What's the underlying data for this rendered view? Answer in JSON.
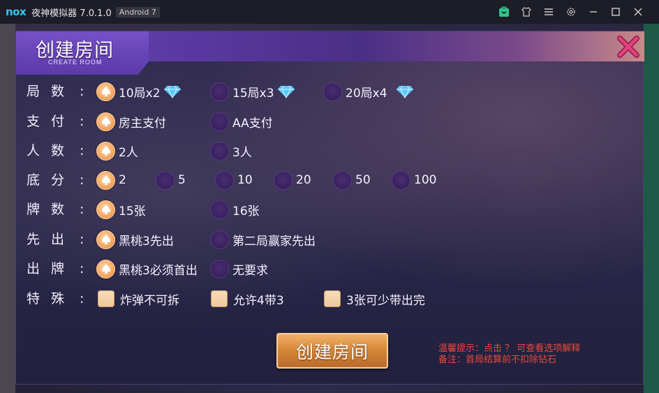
{
  "window": {
    "logo": "nox",
    "title": "夜神模拟器 7.0.1.0",
    "badge": "Android 7",
    "icons": [
      "shop-icon",
      "shirt-icon",
      "menu-icon",
      "gear-icon",
      "minimize-icon",
      "maximize-icon",
      "close-icon"
    ]
  },
  "dialog": {
    "title": "创建房间",
    "subtitle": "CREATE ROOM",
    "colors": {
      "accent_selected": "#f3a865",
      "radio_unselected": "#371f5c",
      "header": "#5a3aa3",
      "note": "#ea4a3a",
      "close": "#e0417c"
    }
  },
  "rows": [
    {
      "label": "局数",
      "colon": ":",
      "options": [
        {
          "text": "10局x2",
          "selected": true,
          "gem": true
        },
        {
          "text": "15局x3",
          "selected": false,
          "gem": true
        },
        {
          "text": "20局x4",
          "selected": false,
          "gem": true
        }
      ]
    },
    {
      "label": "支付",
      "colon": ":",
      "options": [
        {
          "text": "房主支付",
          "selected": true
        },
        {
          "text": "AA支付",
          "selected": false
        }
      ]
    },
    {
      "label": "人数",
      "colon": ":",
      "options": [
        {
          "text": "2人",
          "selected": true
        },
        {
          "text": "3人",
          "selected": false
        }
      ]
    },
    {
      "label": "底分",
      "colon": ":",
      "options": [
        {
          "text": "2",
          "selected": true
        },
        {
          "text": "5",
          "selected": false
        },
        {
          "text": "10",
          "selected": false
        },
        {
          "text": "20",
          "selected": false
        },
        {
          "text": "50",
          "selected": false
        },
        {
          "text": "100",
          "selected": false
        }
      ]
    },
    {
      "label": "牌数",
      "colon": ":",
      "options": [
        {
          "text": "15张",
          "selected": true
        },
        {
          "text": "16张",
          "selected": false
        }
      ]
    },
    {
      "label": "先出",
      "colon": ":",
      "options": [
        {
          "text": "黑桃3先出",
          "selected": true
        },
        {
          "text": "第二局赢家先出",
          "selected": false
        }
      ]
    },
    {
      "label": "出牌",
      "colon": ":",
      "options": [
        {
          "text": "黑桃3必须首出",
          "selected": true
        },
        {
          "text": "无要求",
          "selected": false
        }
      ]
    },
    {
      "label": "特殊",
      "colon": ":",
      "checkboxes": [
        {
          "text": "炸弹不可拆",
          "checked": false
        },
        {
          "text": "允许4带3",
          "checked": false
        },
        {
          "text": "3张可少带出完",
          "checked": false
        }
      ]
    }
  ],
  "create_button": "创建房间",
  "notes": {
    "line1": "温馨提示：点击 ？ 可查看选项解释",
    "line2": "备注：首局结算前不扣除钻石"
  }
}
